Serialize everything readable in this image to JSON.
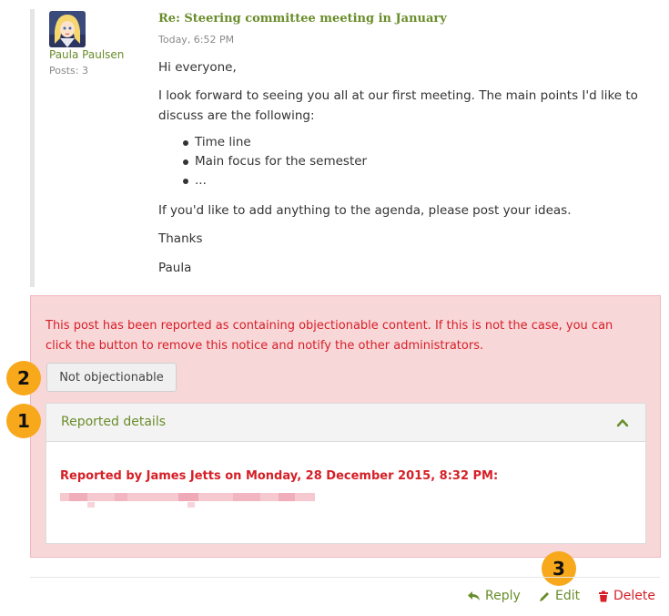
{
  "post": {
    "author": "Paula Paulsen",
    "posts_count": "Posts: 3",
    "title": "Re: Steering committee meeting in January",
    "timestamp": "Today, 6:52 PM",
    "greeting": "Hi everyone,",
    "paragraph1_line1": "I look forward to seeing you all at our first meeting. The main points I'd like to",
    "paragraph1_line2": "discuss are the following:",
    "bullets": [
      "Time line",
      "Main focus for the semester",
      "..."
    ],
    "paragraph2": "If you'd like to add anything to the agenda, please post your ideas.",
    "thanks": "Thanks",
    "signature": "Paula"
  },
  "report": {
    "notice_line1": "This post has been reported as containing objectionable content. If this is not the case, you can",
    "notice_line2": "click the button to remove this notice and notify the other administrators.",
    "not_objectionable_label": "Not objectionable",
    "details_title": "Reported details",
    "reported_by": "Reported by James Jetts on Monday, 28 December 2015, 8:32 PM:"
  },
  "badges": [
    "2",
    "1",
    "3"
  ],
  "actions": {
    "reply": "Reply",
    "edit": "Edit",
    "delete": "Delete"
  },
  "colors": {
    "link_green": "#6a8d2b",
    "alert_red": "#d61f26",
    "alert_bg": "#f8d7d9",
    "badge_orange": "#f7a81b"
  },
  "icons": {
    "reply": "reply-arrow-icon",
    "edit": "pencil-icon",
    "delete": "trash-icon",
    "collapse": "chevron-up-icon"
  }
}
